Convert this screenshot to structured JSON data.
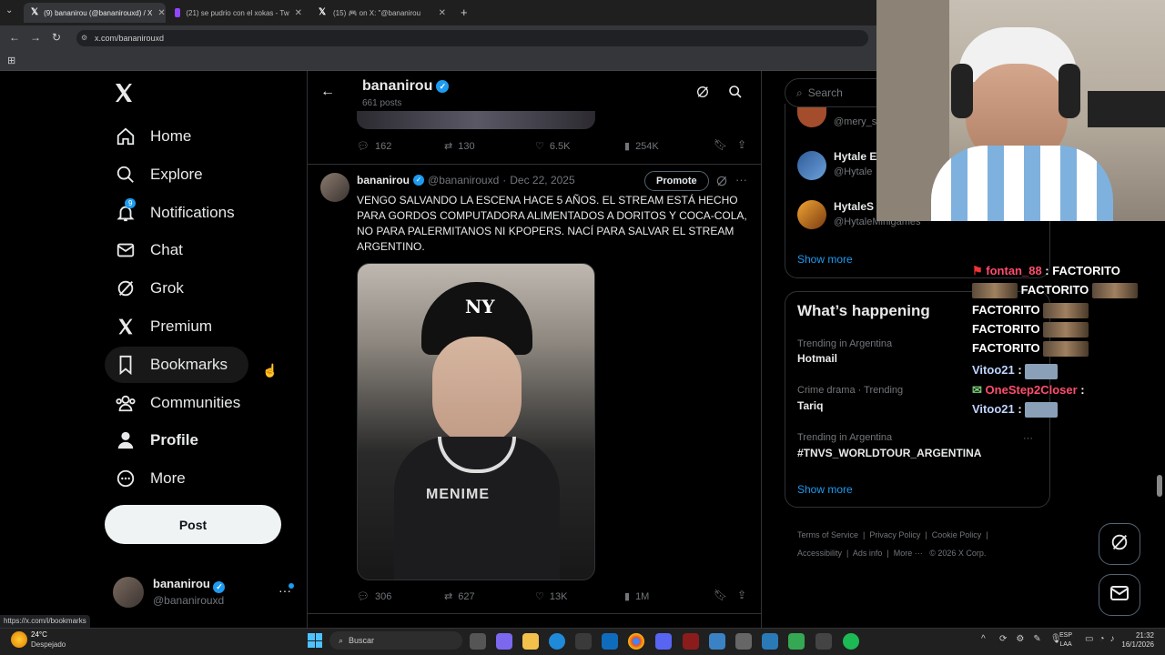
{
  "browser": {
    "tabs": [
      {
        "label": "(9) bananirou (@bananirouxd) / X"
      },
      {
        "label": "(21) se pudrio con el xokas - Tw"
      },
      {
        "label": "(15) 🎮 on X: \"@bananirou"
      }
    ],
    "url": "x.com/bananirouxd",
    "status_url": "https://x.com/i/bookmarks"
  },
  "nav": {
    "items": [
      {
        "label": "Home",
        "icon": "home-icon"
      },
      {
        "label": "Explore",
        "icon": "search-icon"
      },
      {
        "label": "Notifications",
        "icon": "bell-icon",
        "badge": "9"
      },
      {
        "label": "Chat",
        "icon": "mail-icon"
      },
      {
        "label": "Grok",
        "icon": "grok-icon"
      },
      {
        "label": "Premium",
        "icon": "x-logo-icon"
      },
      {
        "label": "Bookmarks",
        "icon": "bookmark-icon"
      },
      {
        "label": "Communities",
        "icon": "communities-icon"
      },
      {
        "label": "Profile",
        "icon": "person-icon"
      },
      {
        "label": "More",
        "icon": "more-icon"
      }
    ],
    "post_label": "Post",
    "account": {
      "name": "bananirou",
      "handle": "@bananirouxd"
    }
  },
  "profile_header": {
    "name": "bananirou",
    "posts": "661 posts"
  },
  "prev_tweet_actions": {
    "replies": "162",
    "reposts": "130",
    "likes": "6.5K",
    "views": "254K"
  },
  "tweet": {
    "name": "bananirou",
    "handle": "@bananirouxd",
    "date": "Dec 22, 2025",
    "promote_label": "Promote",
    "text": "VENGO SALVANDO LA ESCENA HACE 5 AÑOS. EL STREAM ESTÁ HECHO PARA GORDOS COMPUTADORA ALIMENTADOS A DORITOS Y COCA-COLA, NO PARA PALERMITANOS NI KPOPERS. NACÍ PARA SALVAR EL STREAM ARGENTINO.",
    "actions": {
      "replies": "306",
      "reposts": "627",
      "likes": "13K",
      "views": "1M"
    }
  },
  "right": {
    "search_placeholder": "Search",
    "follow": [
      {
        "name": "",
        "handle": "@mery_s"
      },
      {
        "name": "Hytale E",
        "handle": "@Hytale"
      },
      {
        "name": "HytaleS",
        "handle": "@HytaleMinigames"
      }
    ],
    "show_more": "Show more",
    "happening_title": "What’s happening",
    "trends": [
      {
        "context": "Trending in Argentina",
        "topic": "Hotmail"
      },
      {
        "context": "Crime drama · Trending",
        "topic": "Tariq"
      },
      {
        "context": "Trending in Argentina",
        "topic": "#TNVS_WORLDTOUR_ARGENTINA"
      }
    ],
    "show_more2": "Show more",
    "footer": [
      "Terms of Service",
      "Privacy Policy",
      "Cookie Policy",
      "Accessibility",
      "Ads info",
      "More ···",
      "© 2026 X Corp."
    ]
  },
  "stream_chat": [
    {
      "user": "fontan_88",
      "msg": "FACTORITO",
      "color": "#ff4d6d"
    },
    {
      "user": "",
      "msg": "FACTORITO",
      "color": "#ffffff"
    },
    {
      "user": "",
      "msg": "FACTORITO",
      "color": "#ffffff"
    },
    {
      "user": "",
      "msg": "FACTORITO",
      "color": "#ffffff"
    },
    {
      "user": "",
      "msg": "FACTORITO",
      "color": "#ffffff"
    },
    {
      "user": "Vitoo21",
      "msg": "",
      "color": "#bfd4ff"
    },
    {
      "user": "OneStep2Closer",
      "msg": "",
      "color": "#ff4d6d"
    },
    {
      "user": "Vitoo21",
      "msg": "",
      "color": "#bfd4ff"
    }
  ],
  "taskbar": {
    "weather_temp": "24°C",
    "weather_desc": "Despejado",
    "search_placeholder": "Buscar",
    "lang1": "ESP",
    "lang2": "LAA",
    "time": "21:32",
    "date": "16/1/2026"
  },
  "colors": {
    "accent": "#1d9bf0",
    "bg": "#000000",
    "border": "#2f3336",
    "muted": "#71767b"
  }
}
